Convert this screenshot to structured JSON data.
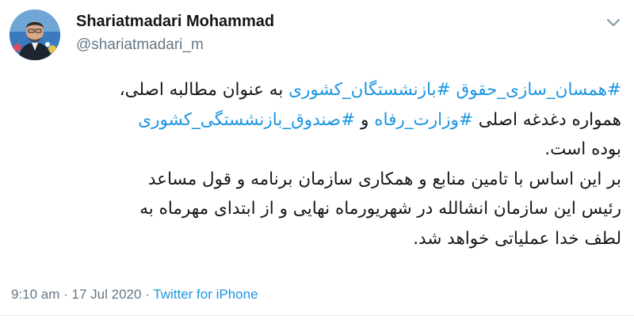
{
  "user": {
    "display_name": "Shariatmadari Mohammad",
    "handle": "@shariatmadari_m"
  },
  "menu_icon": "chevron-down-icon",
  "tweet": {
    "line1": {
      "tag1": "#همسان_سازی_حقوق",
      "tag2": "#بازنشستگان_کشوری",
      "text": " به عنوان مطالبه اصلی،"
    },
    "line2": {
      "text1": "همواره دغدغه اصلی ",
      "tag1": "#وزارت_رفاه",
      "text2": " و ",
      "tag2": "#صندوق_بازنشستگی_کشوری"
    },
    "line3": "بوده است.",
    "line4": "بر این اساس با تامین منابع و همکاری سازمان برنامه و قول مساعد",
    "line5": "رئیس این سازمان انشالله در شهریورماه نهایی و از ابتدای مهرماه به",
    "line6": "لطف خدا عملیاتی خواهد شد."
  },
  "meta": {
    "time": "9:10 am",
    "separator1": " · ",
    "date": "17 Jul 2020",
    "separator2": " · ",
    "source": "Twitter for iPhone"
  },
  "colors": {
    "hashtag": "#1b95e0",
    "secondary_text": "#657786",
    "primary_text": "#14171a"
  }
}
